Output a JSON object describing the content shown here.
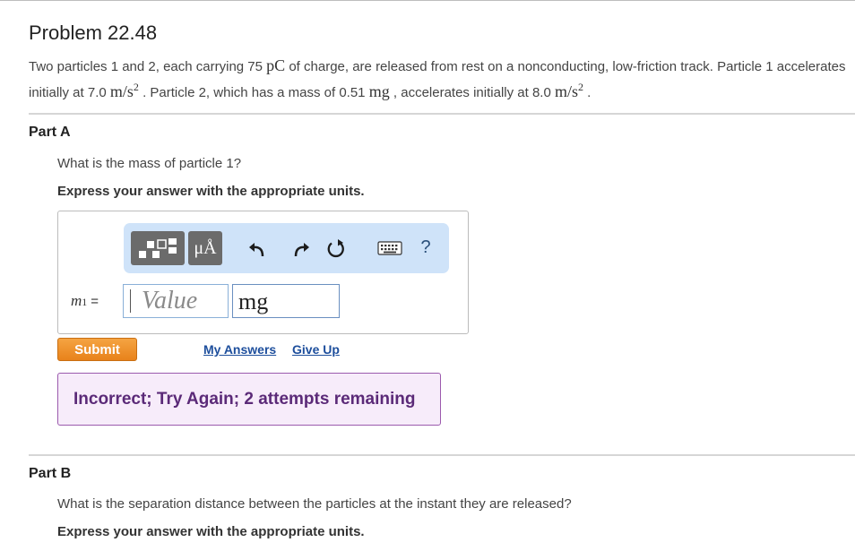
{
  "problem": {
    "title": "Problem 22.48",
    "statement": {
      "t1": "Two particles 1 and 2, each carrying 75 ",
      "m1": "pC",
      "t2": " of charge, are released from rest on a nonconducting, low-friction track. Particle 1 accelerates initially at 7.0 ",
      "m2": "m/s",
      "t3": " . Particle 2, which has a mass of 0.51 ",
      "m3": "mg",
      "t4": " , accelerates initially at 8.0 ",
      "m4": "m/s",
      "t5": " .",
      "exp": "2"
    }
  },
  "part_a": {
    "label": "Part A",
    "question": "What is the mass of particle 1?",
    "instruction": "Express your answer with the appropriate units.",
    "toolbar": {
      "units_symbol": "μÅ",
      "help_label": "?"
    },
    "variable": {
      "symbol": "m",
      "subscript": "1",
      "equals": "="
    },
    "value_placeholder": "Value",
    "unit_value": "mg",
    "submit_label": "Submit",
    "my_answers_label": "My Answers",
    "give_up_label": "Give Up",
    "feedback": "Incorrect; Try Again; 2 attempts remaining"
  },
  "part_b": {
    "label": "Part B",
    "question": "What is the separation distance between the particles at the instant they are released?",
    "instruction": "Express your answer with the appropriate units."
  },
  "colors": {
    "toolbar_bg": "#cfe3f9",
    "submit": "#f0951f",
    "feedback_bg": "#f7ecfa",
    "feedback_text": "#5b2a78",
    "link": "#1d4e9c"
  }
}
